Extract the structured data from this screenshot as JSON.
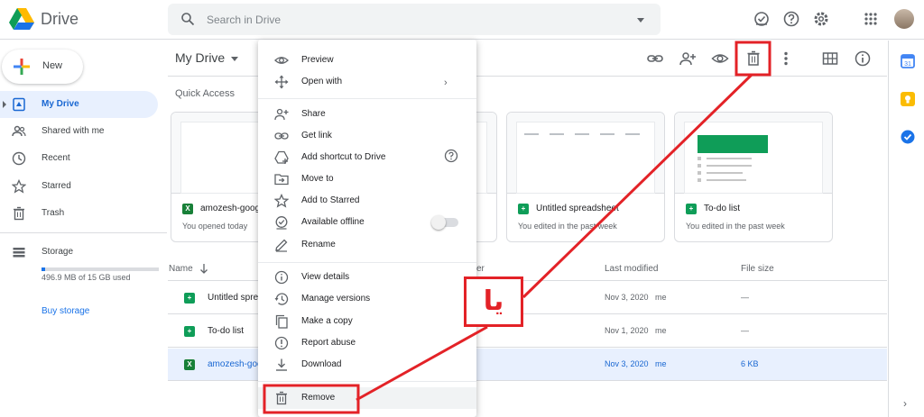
{
  "header": {
    "app_name": "Drive",
    "search_placeholder": "Search in Drive"
  },
  "sidebar": {
    "new_label": "New",
    "items": [
      {
        "label": "My Drive",
        "icon": "my-drive-icon",
        "active": true
      },
      {
        "label": "Shared with me",
        "icon": "people-icon",
        "active": false
      },
      {
        "label": "Recent",
        "icon": "clock-icon",
        "active": false
      },
      {
        "label": "Starred",
        "icon": "star-icon",
        "active": false
      },
      {
        "label": "Trash",
        "icon": "trash-icon",
        "active": false
      }
    ],
    "storage_label": "Storage",
    "storage_used": "496.9 MB of 15 GB used",
    "storage_fraction": 0.032,
    "buy_storage": "Buy storage"
  },
  "main": {
    "title": "My Drive",
    "quick_access_title": "Quick Access",
    "cards": [
      {
        "name": "amozesh-goog",
        "meta": "You opened today",
        "type": "excel"
      },
      {
        "name": "",
        "meta": "",
        "type": "sheets"
      },
      {
        "name": "Untitled spreadsheet",
        "meta": "You edited in the past week",
        "type": "sheets"
      },
      {
        "name": "To-do list",
        "meta": "You edited in the past week",
        "type": "sheets"
      }
    ],
    "list_headers": {
      "name": "Name",
      "owner": "er",
      "modified": "Last modified",
      "size": "File size"
    },
    "rows": [
      {
        "name": "Untitled spre",
        "modified": "Nov 3, 2020",
        "owner": "me",
        "size": "—",
        "type": "sheets",
        "selected": false
      },
      {
        "name": "To-do list",
        "modified": "Nov 1, 2020",
        "owner": "me",
        "size": "—",
        "type": "sheets",
        "selected": false
      },
      {
        "name": "amozesh-goo",
        "modified": "Nov 3, 2020",
        "owner": "me",
        "size": "6 KB",
        "type": "excel",
        "selected": true
      }
    ]
  },
  "context_menu": {
    "items": [
      {
        "label": "Preview",
        "icon": "eye-icon"
      },
      {
        "label": "Open with",
        "icon": "move-arrows-icon"
      },
      {
        "label": "Share",
        "icon": "person-add-icon"
      },
      {
        "label": "Get link",
        "icon": "link-icon"
      },
      {
        "label": "Add shortcut to Drive",
        "icon": "shortcut-icon"
      },
      {
        "label": "Move to",
        "icon": "folder-move-icon"
      },
      {
        "label": "Add to Starred",
        "icon": "star-icon"
      },
      {
        "label": "Available offline",
        "icon": "offline-icon"
      },
      {
        "label": "Rename",
        "icon": "pencil-icon"
      },
      {
        "label": "View details",
        "icon": "info-icon"
      },
      {
        "label": "Manage versions",
        "icon": "history-icon"
      },
      {
        "label": "Make a copy",
        "icon": "copy-icon"
      },
      {
        "label": "Report abuse",
        "icon": "report-icon"
      },
      {
        "label": "Download",
        "icon": "download-icon"
      },
      {
        "label": "Remove",
        "icon": "trash-icon"
      }
    ]
  },
  "annotation": {
    "label": "یا",
    "color": "#e32227"
  },
  "colors": {
    "accent": "#1a73e8",
    "selected_bg": "#e8f0fe",
    "sheets_green": "#0f9d58",
    "excel_green": "#188038"
  }
}
